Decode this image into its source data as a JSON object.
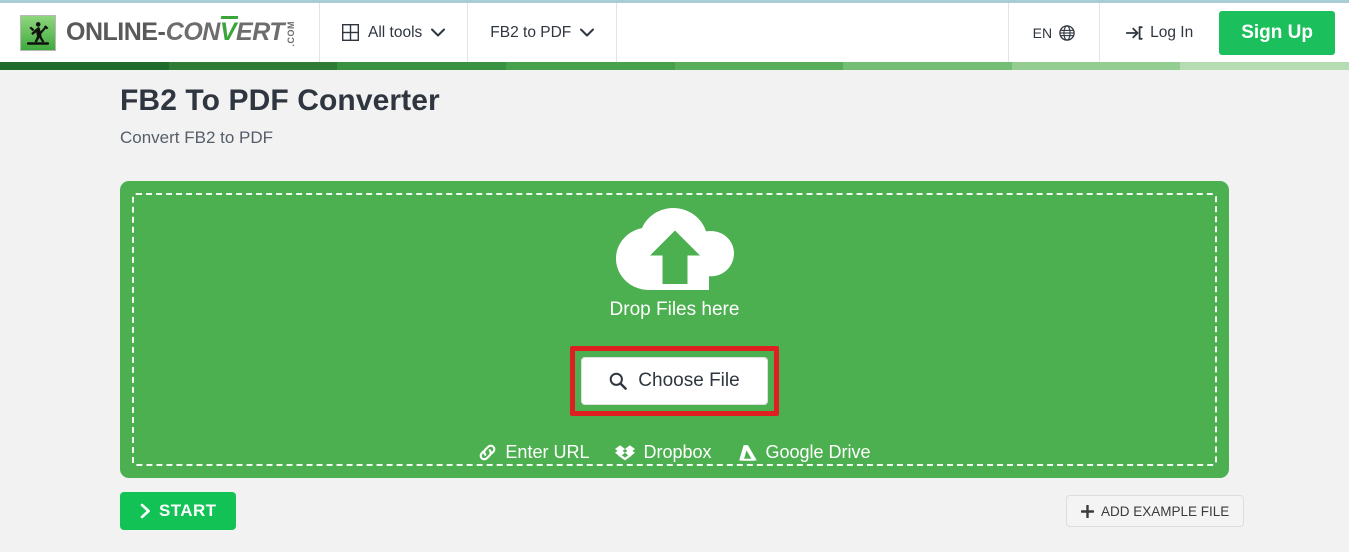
{
  "browser": {
    "top_edge_color": "#a9cdd4"
  },
  "header": {
    "brand": {
      "word_1": "ONLINE",
      "dash": "-",
      "word_2a": "CON",
      "word_2b": "V",
      "word_2c": "ERT",
      "tld": ".COM",
      "logo_icon": "running-person-icon"
    },
    "nav": [
      {
        "label": "All tools",
        "icon": "grid-icon",
        "caret": "chevron-down-icon"
      },
      {
        "label": "FB2 to PDF",
        "icon": "",
        "caret": "chevron-down-icon"
      }
    ],
    "language": {
      "label": "EN",
      "icon": "globe-icon"
    },
    "login": {
      "label": "Log In",
      "icon": "sign-in-icon"
    },
    "signup": {
      "label": "Sign Up",
      "color": "#1bbf5c"
    }
  },
  "segment_bar": {
    "colors": [
      "#1f6b2c",
      "#2f7c36",
      "#389241",
      "#47a04c",
      "#58ad5b",
      "#74bd74",
      "#93cd92",
      "#b5dcb2"
    ]
  },
  "main": {
    "title": "FB2 To PDF Converter",
    "subtitle": "Convert FB2 to PDF",
    "dropzone": {
      "background_color": "#4caf50",
      "cloud_icon": "cloud-upload-icon",
      "drop_label": "Drop Files here",
      "choose_file": {
        "label": "Choose File",
        "icon": "magnifier-icon",
        "highlight_color": "#e02020"
      },
      "sources": [
        {
          "label": "Enter URL",
          "icon": "link-icon"
        },
        {
          "label": "Dropbox",
          "icon": "dropbox-icon"
        },
        {
          "label": "Google Drive",
          "icon": "google-drive-icon"
        }
      ]
    },
    "start_button": {
      "label": "START",
      "icon": "chevron-right-icon",
      "color": "#13c255"
    },
    "add_example_button": {
      "label": "ADD EXAMPLE FILE",
      "icon": "plus-icon"
    }
  }
}
